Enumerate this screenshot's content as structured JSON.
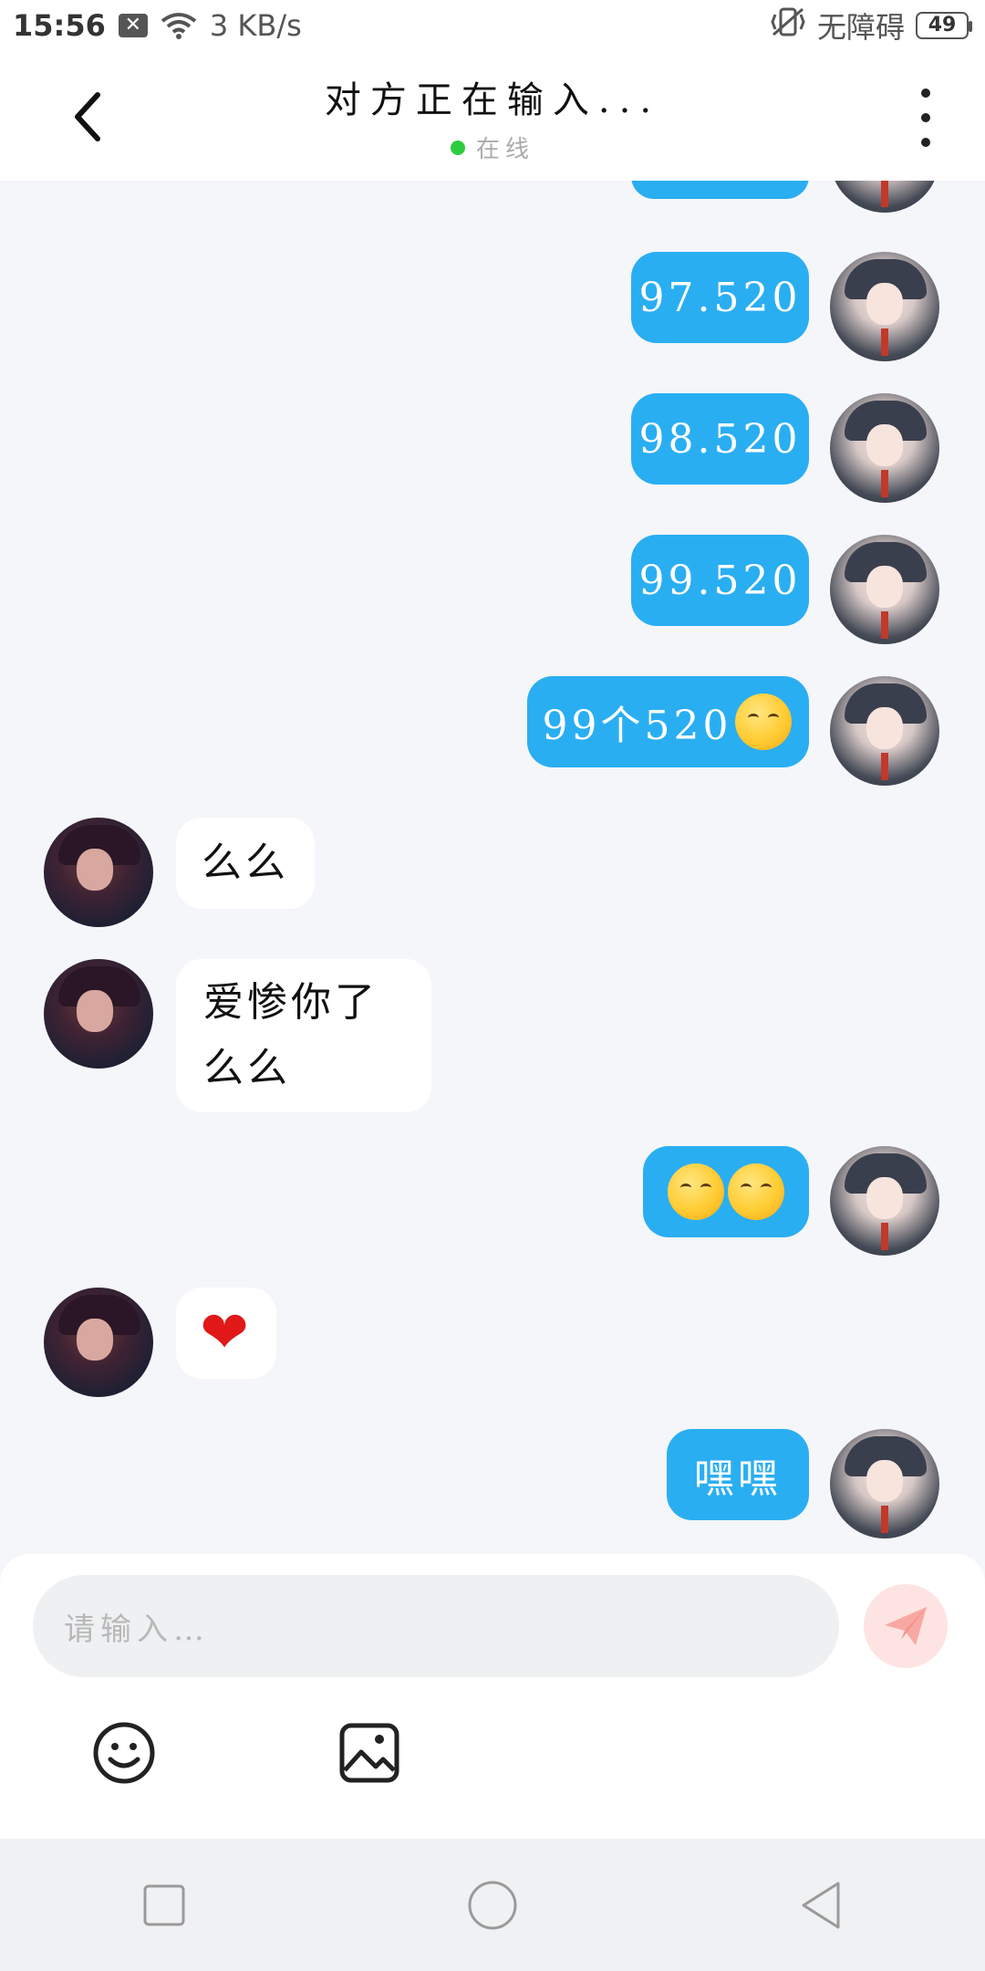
{
  "status_bar": {
    "time": "15:56",
    "speed": "3 KB/s",
    "accessibility": "无障碍",
    "battery": "49"
  },
  "header": {
    "title": "对方正在输入...",
    "online_status": "在线"
  },
  "messages": [
    {
      "sender": "me",
      "text": "97.520"
    },
    {
      "sender": "me",
      "text": "98.520"
    },
    {
      "sender": "me",
      "text": "99.520"
    },
    {
      "sender": "me",
      "text": "99个520",
      "emoji": "kissing-face"
    },
    {
      "sender": "them",
      "text": "么么"
    },
    {
      "sender": "them",
      "lines": [
        "爱惨你了",
        "么么"
      ]
    },
    {
      "sender": "me",
      "emoji": "smiling-face x2"
    },
    {
      "sender": "them",
      "emoji": "red-heart"
    },
    {
      "sender": "me",
      "text": "嘿嘿"
    }
  ],
  "input": {
    "placeholder": "请输入…"
  },
  "colors": {
    "my_bubble": "#2aaef2",
    "their_bubble": "#ffffff",
    "online_dot": "#2ecc40",
    "send_button": "#fde4e2"
  }
}
